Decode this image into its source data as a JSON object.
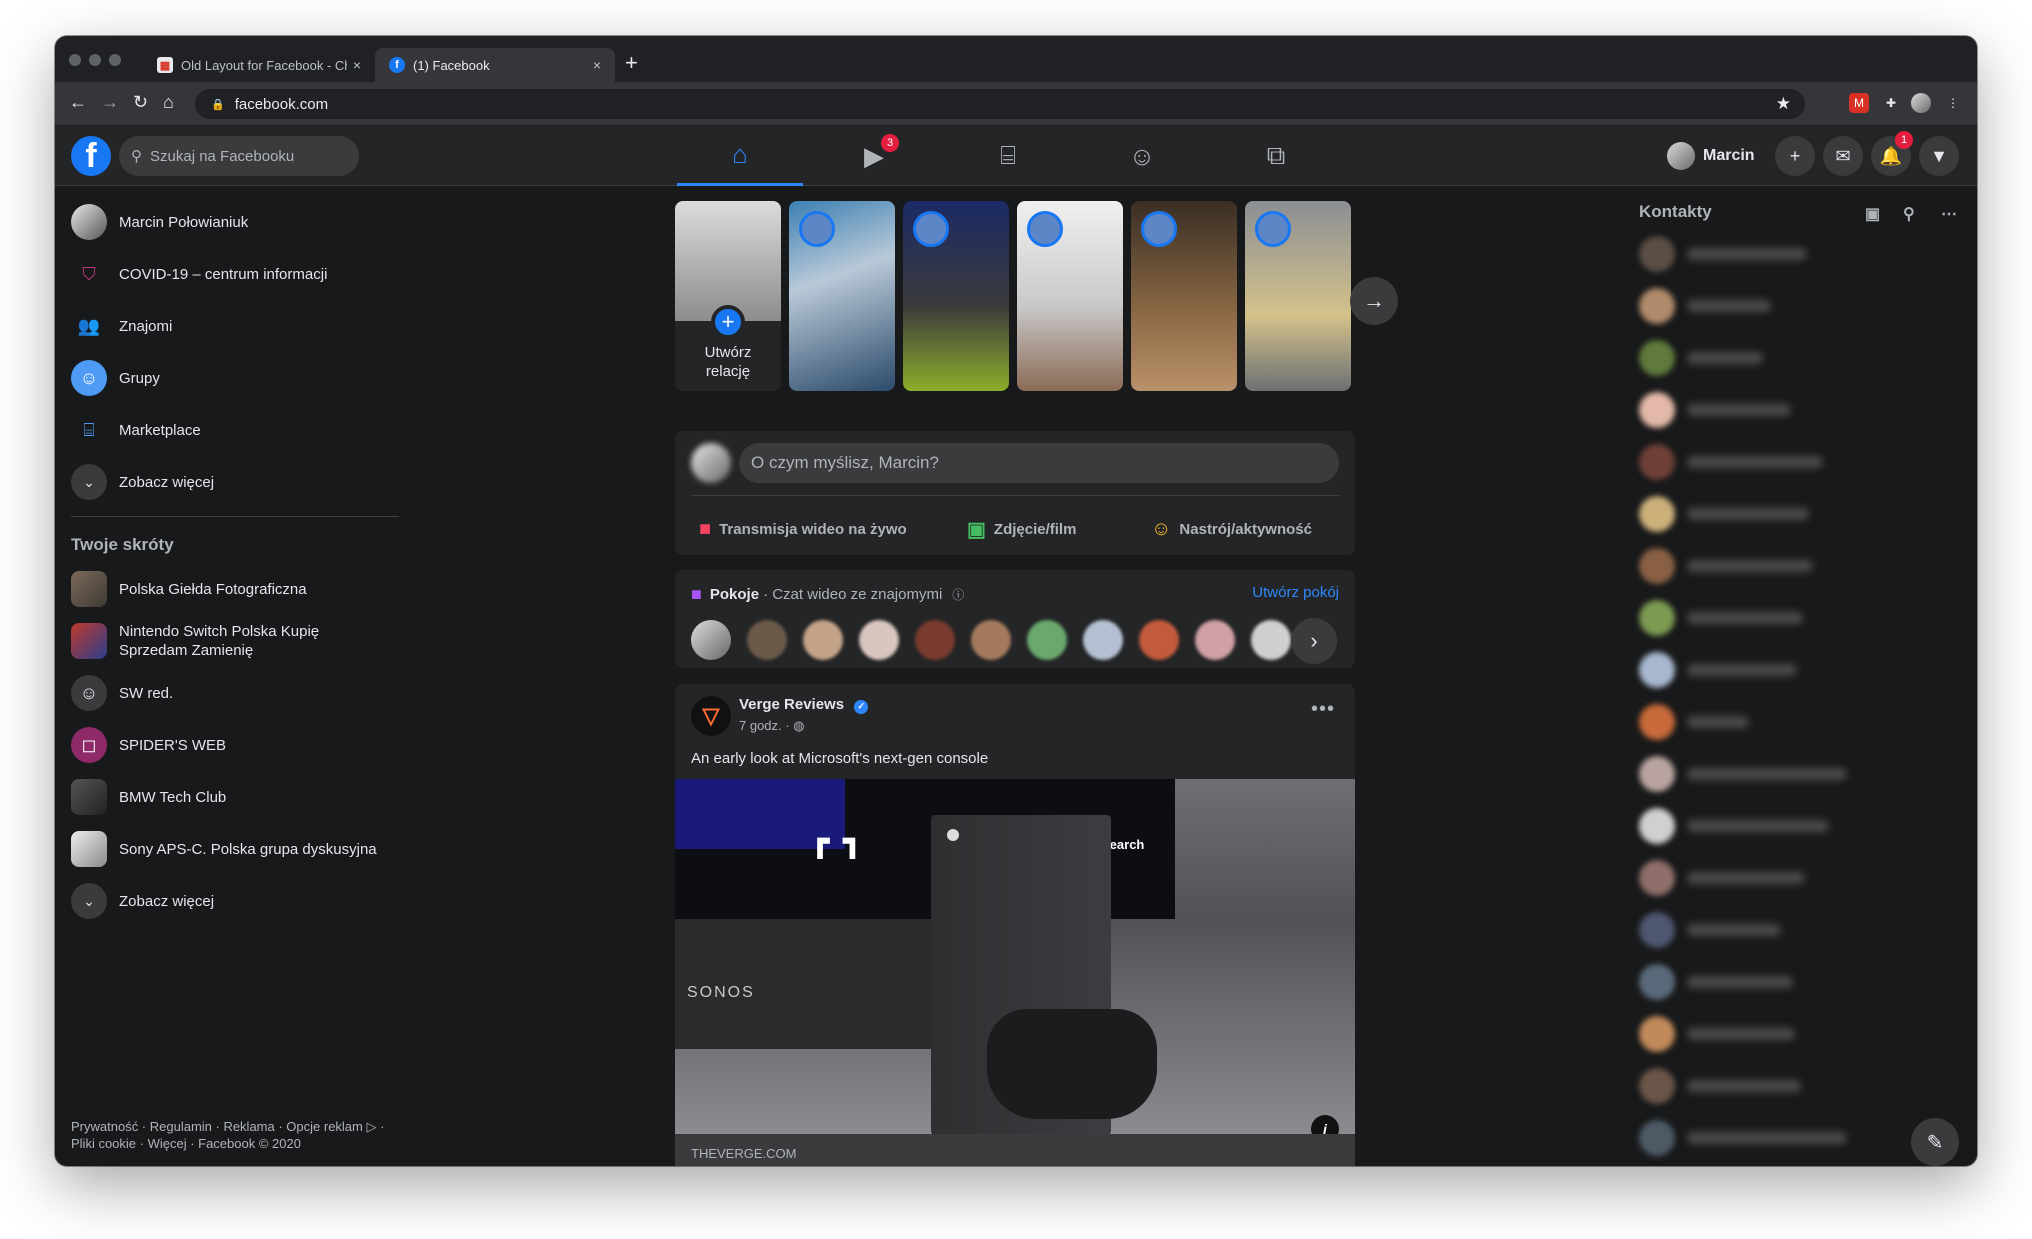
{
  "browser": {
    "tabs": [
      {
        "title": "Old Layout for Facebook - Chr",
        "close": "×"
      },
      {
        "title": "(1) Facebook",
        "close": "×"
      }
    ],
    "new_tab": "+",
    "url": "facebook.com"
  },
  "header": {
    "search_placeholder": "Szukaj na Facebooku",
    "watch_badge": "3",
    "profile_name": "Marcin",
    "notifications_badge": "1",
    "accent": "#2d88ff"
  },
  "sidebar": {
    "items": [
      {
        "label": "Marcin Połowianiuk",
        "icon": "avatar"
      },
      {
        "label": "COVID-19 – centrum informacji",
        "icon": "shield-heart-icon"
      },
      {
        "label": "Znajomi",
        "icon": "friends-icon"
      },
      {
        "label": "Grupy",
        "icon": "groups-icon"
      },
      {
        "label": "Marketplace",
        "icon": "shop-icon"
      },
      {
        "label": "Zobacz więcej",
        "icon": "chevron-down-icon"
      }
    ],
    "shortcuts_title": "Twoje skróty",
    "shortcuts": [
      {
        "label": "Polska Giełda Fotograficzna"
      },
      {
        "label": "Nintendo Switch Polska Kupię Sprzedam Zamienię"
      },
      {
        "label": "SW red."
      },
      {
        "label": "SPIDER'S WEB"
      },
      {
        "label": "BMW Tech Club"
      },
      {
        "label": "Sony APS-C. Polska grupa dyskusyjna"
      },
      {
        "label": "Zobacz więcej"
      }
    ],
    "footer_line1": "Prywatność · Regulamin · Reklama · Opcje reklam ▷ ·",
    "footer_line2": "Pliki cookie · Więcej · Facebook © 2020"
  },
  "stories": {
    "create_label_1": "Utwórz",
    "create_label_2": "relację"
  },
  "composer": {
    "placeholder": "O czym myślisz, Marcin?",
    "actions": [
      {
        "label": "Transmisja wideo na żywo",
        "icon": "live-video-icon",
        "color": "#f3425f"
      },
      {
        "label": "Zdjęcie/film",
        "icon": "photo-icon",
        "color": "#45bd62"
      },
      {
        "label": "Nastrój/aktywność",
        "icon": "smiley-icon",
        "color": "#f7b928"
      }
    ]
  },
  "rooms": {
    "title": "Pokoje",
    "subtitle": "· Czat wideo ze znajomymi",
    "create_link": "Utwórz pokój"
  },
  "post": {
    "author": "Verge Reviews",
    "time": "7 godz. ·",
    "text": "An early look at Microsoft's next-gen console",
    "image_overlay_search": "Search",
    "image_overlay_brand": "SONOS",
    "link_domain": "THEVERGE.COM"
  },
  "contacts": {
    "title": "Kontakty"
  }
}
